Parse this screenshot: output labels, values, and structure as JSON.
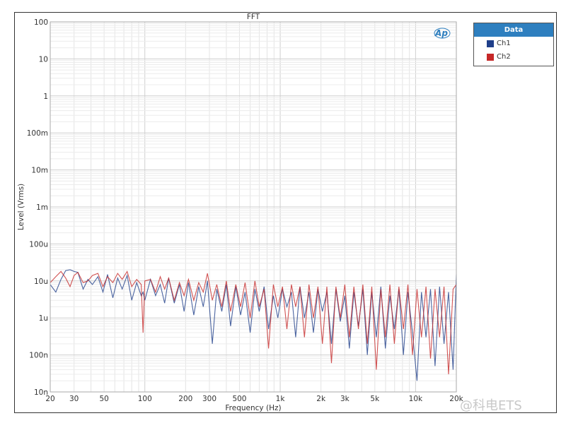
{
  "chart_data": {
    "type": "line",
    "title": "FFT",
    "xlabel": "Frequency (Hz)",
    "ylabel": "Level (Vrms)",
    "xscale": "log",
    "yscale": "log",
    "xlim": [
      20,
      20000
    ],
    "ylim": [
      1e-08,
      100
    ],
    "grid": true,
    "legend": {
      "title": "Data",
      "placement": "right-outside-top"
    },
    "x_ticks": [
      {
        "v": 20,
        "label": "20"
      },
      {
        "v": 30,
        "label": "30"
      },
      {
        "v": 50,
        "label": "50"
      },
      {
        "v": 100,
        "label": "100"
      },
      {
        "v": 200,
        "label": "200"
      },
      {
        "v": 300,
        "label": "300"
      },
      {
        "v": 500,
        "label": "500"
      },
      {
        "v": 1000,
        "label": "1k"
      },
      {
        "v": 2000,
        "label": "2k"
      },
      {
        "v": 3000,
        "label": "3k"
      },
      {
        "v": 5000,
        "label": "5k"
      },
      {
        "v": 10000,
        "label": "10k"
      },
      {
        "v": 20000,
        "label": "20k"
      }
    ],
    "y_ticks": [
      {
        "v": 100,
        "label": "100"
      },
      {
        "v": 10,
        "label": "10"
      },
      {
        "v": 1,
        "label": "1"
      },
      {
        "v": 0.1,
        "label": "100m"
      },
      {
        "v": 0.01,
        "label": "10m"
      },
      {
        "v": 0.001,
        "label": "1m"
      },
      {
        "v": 0.0001,
        "label": "100u"
      },
      {
        "v": 1e-05,
        "label": "10u"
      },
      {
        "v": 1e-06,
        "label": "1u"
      },
      {
        "v": 1e-07,
        "label": "100n"
      },
      {
        "v": 1e-08,
        "label": "10n"
      }
    ],
    "x": [
      20,
      22,
      24,
      26,
      28,
      30,
      32,
      35,
      38,
      41,
      45,
      49,
      53,
      58,
      63,
      68,
      74,
      80,
      87,
      94,
      97,
      100,
      110,
      120,
      130,
      140,
      150,
      165,
      180,
      195,
      210,
      230,
      250,
      270,
      290,
      315,
      340,
      370,
      400,
      430,
      470,
      510,
      550,
      600,
      650,
      700,
      760,
      820,
      890,
      960,
      1040,
      1120,
      1210,
      1300,
      1400,
      1510,
      1630,
      1760,
      1900,
      2050,
      2210,
      2390,
      2580,
      2780,
      3000,
      3240,
      3500,
      3780,
      4080,
      4400,
      4750,
      5130,
      5540,
      5980,
      6460,
      6970,
      7530,
      8130,
      8780,
      9480,
      10240,
      11050,
      11940,
      12890,
      13920,
      15030,
      16230,
      17530,
      18930,
      20000
    ],
    "series": [
      {
        "name": "Ch1",
        "color": "#1f3f8a",
        "values": [
          8e-06,
          5e-06,
          1.1e-05,
          1.9e-05,
          2e-05,
          1.8e-05,
          1.7e-05,
          6e-06,
          1.1e-05,
          8e-06,
          1.3e-05,
          5e-06,
          1.5e-05,
          3.5e-06,
          1.2e-05,
          6e-06,
          1.4e-05,
          3e-06,
          9e-06,
          4e-06,
          5e-06,
          3e-06,
          1.1e-05,
          4e-06,
          8e-06,
          2.5e-06,
          1.2e-05,
          2.5e-06,
          8e-06,
          1.5e-06,
          9e-06,
          1.2e-06,
          7e-06,
          2e-06,
          1e-05,
          2e-07,
          6e-06,
          1.5e-06,
          8e-06,
          6e-07,
          7e-06,
          1.2e-06,
          5e-06,
          4e-07,
          6e-06,
          1.5e-06,
          7e-06,
          5e-07,
          4e-06,
          1e-06,
          6e-06,
          2e-06,
          5e-06,
          3e-07,
          7e-06,
          1e-06,
          5e-06,
          4e-07,
          6e-06,
          1.5e-06,
          5e-06,
          2e-07,
          6e-06,
          8e-07,
          4e-06,
          1.5e-07,
          5e-06,
          6e-07,
          6e-06,
          1e-07,
          5e-06,
          3e-07,
          7e-06,
          1.5e-07,
          4e-06,
          5e-07,
          6e-06,
          1e-07,
          5e-06,
          4e-07,
          2e-08,
          5e-06,
          3e-07,
          6e-06,
          5e-08,
          7e-06,
          2e-07,
          5e-06,
          4e-08,
          1.5e-05
        ]
      },
      {
        "name": "Ch2",
        "color": "#c62828",
        "values": [
          9e-06,
          1.3e-05,
          1.8e-05,
          1.2e-05,
          7e-06,
          1.4e-05,
          1.7e-05,
          9e-06,
          1e-05,
          1.4e-05,
          1.6e-05,
          7e-06,
          1.3e-05,
          9e-06,
          1.6e-05,
          1.1e-05,
          1.8e-05,
          7e-06,
          1.1e-05,
          8e-06,
          4e-07,
          1e-05,
          1.1e-05,
          5e-06,
          1.3e-05,
          6e-06,
          1.2e-05,
          3e-06,
          9e-06,
          4e-06,
          1.1e-05,
          3e-06,
          9e-06,
          5e-06,
          1.6e-05,
          3e-06,
          8e-06,
          2e-06,
          1e-05,
          1.5e-06,
          8e-06,
          2e-06,
          9e-06,
          1e-06,
          1e-05,
          2e-06,
          6e-06,
          1.5e-07,
          8e-06,
          2e-06,
          7e-06,
          5e-07,
          8e-06,
          2e-06,
          7e-06,
          3e-07,
          8e-06,
          1e-06,
          7e-06,
          2e-07,
          7e-06,
          6e-08,
          7e-06,
          1e-06,
          8e-06,
          3e-07,
          7e-06,
          5e-07,
          8e-06,
          2e-07,
          7e-06,
          4e-08,
          6e-06,
          3e-07,
          8e-06,
          2e-07,
          7e-06,
          5e-07,
          8e-06,
          1e-07,
          6e-06,
          3e-07,
          7e-06,
          8e-08,
          6e-06,
          3e-07,
          7e-06,
          3e-08,
          6e-06,
          8e-06
        ]
      }
    ]
  },
  "logo": "AP",
  "watermark": "@科电ETS"
}
